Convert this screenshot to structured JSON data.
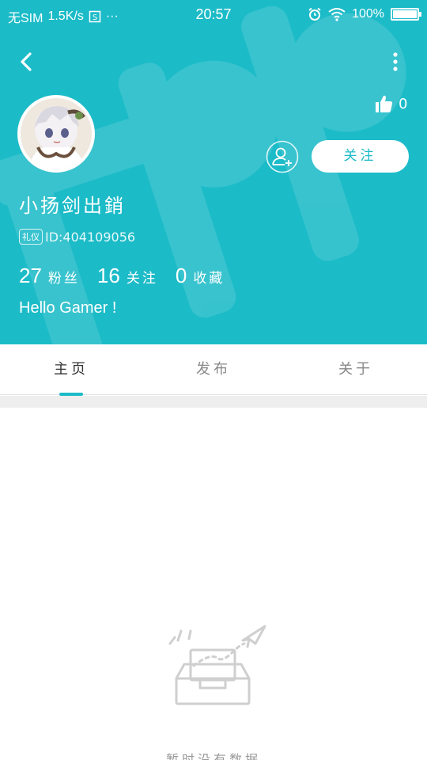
{
  "status_bar": {
    "carrier": "无SIM",
    "net_speed": "1.5K/s",
    "dots": "···",
    "time": "20:57",
    "battery": "100%",
    "battery_level": 1.0,
    "icons": [
      "sim-icon",
      "alarm-icon",
      "wifi-icon",
      "battery-icon"
    ]
  },
  "header": {
    "background": "#1cbbc8",
    "likes": "0"
  },
  "profile": {
    "name": "小扬剑出銷",
    "badge": "礼仪",
    "id": "ID:404109056",
    "stats": [
      {
        "num": "27",
        "label": "粉丝"
      },
      {
        "num": "16",
        "label": "关注"
      },
      {
        "num": "0",
        "label": "收藏"
      }
    ],
    "bio": "Hello Gamer !"
  },
  "actions": {
    "follow_label": "关注"
  },
  "tabs": [
    {
      "label": "主页",
      "active": true
    },
    {
      "label": "发布",
      "active": false
    },
    {
      "label": "关于",
      "active": false
    }
  ],
  "empty_state": {
    "text": "暂时没有数据"
  }
}
